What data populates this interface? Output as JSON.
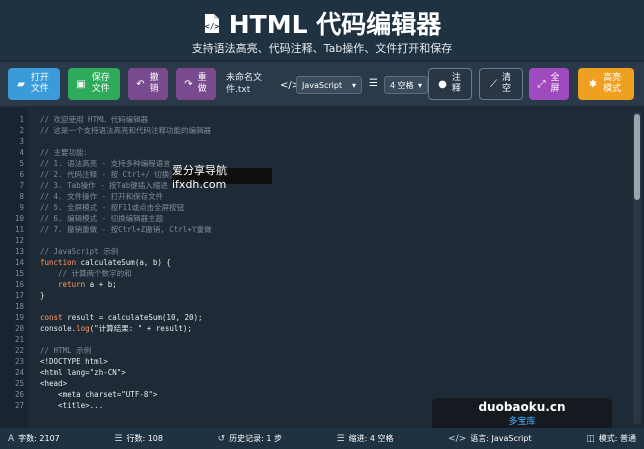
{
  "header": {
    "title": "HTML 代码编辑器",
    "subtitle": "支持语法高亮、代码注释、Tab操作、文件打开和保存"
  },
  "toolbar": {
    "open_label": "打开文件",
    "save_label": "保存文件",
    "undo_label": "撤销",
    "redo_label": "重做",
    "file_name": "未命名文件.txt",
    "language": "JavaScript",
    "indent": "4 空格",
    "comment_label": "注释",
    "clear_label": "清空",
    "fullscreen_label": "全屏",
    "highlight_label": "高亮模式"
  },
  "editor": {
    "lines": [
      {
        "n": "1",
        "t": "// 欢迎使用 HTML 代码编辑器",
        "c": "com"
      },
      {
        "n": "2",
        "t": "// 这是一个支持语法高亮和代码注释功能的编辑器",
        "c": "com"
      },
      {
        "n": "3",
        "t": "",
        "c": ""
      },
      {
        "n": "4",
        "t": "// 主要功能：",
        "c": "com"
      },
      {
        "n": "5",
        "t": "// 1. 语法高亮 - 支持多种编程语言",
        "c": "com"
      },
      {
        "n": "6",
        "t": "// 2. 代码注释 - 按 Ctrl+/ 切换注释",
        "c": "com"
      },
      {
        "n": "7",
        "t": "// 3. Tab操作 - 按Tab键插入缩进",
        "c": "com"
      },
      {
        "n": "8",
        "t": "// 4. 文件操作 - 打开和保存文件",
        "c": "com"
      },
      {
        "n": "9",
        "t": "// 5. 全屏模式 - 按F11或点击全屏按钮",
        "c": "com"
      },
      {
        "n": "10",
        "t": "// 6. 编辑模式 - 切换编辑器主题",
        "c": "com"
      },
      {
        "n": "11",
        "t": "// 7. 撤销重做 - 按Ctrl+Z撤销, Ctrl+Y重做",
        "c": "com"
      },
      {
        "n": "12",
        "t": "",
        "c": ""
      },
      {
        "n": "13",
        "t": "// JavaScript 示例",
        "c": "com"
      },
      {
        "n": "14",
        "t": "function calculateSum(a, b) {",
        "c": "fn"
      },
      {
        "n": "15",
        "t": "    // 计算两个数字的和",
        "c": "com"
      },
      {
        "n": "16",
        "t": "    return a + b;",
        "c": "ret"
      },
      {
        "n": "17",
        "t": "}",
        "c": ""
      },
      {
        "n": "18",
        "t": "",
        "c": ""
      },
      {
        "n": "19",
        "t": "const result = calculateSum(10, 20);",
        "c": "const"
      },
      {
        "n": "20",
        "t": "console.log(\"计算结果: \" + result);",
        "c": "log"
      },
      {
        "n": "21",
        "t": "",
        "c": ""
      },
      {
        "n": "22",
        "t": "// HTML 示例",
        "c": "com"
      },
      {
        "n": "23",
        "t": "<!DOCTYPE html>",
        "c": ""
      },
      {
        "n": "24",
        "t": "<html lang=\"zh-CN\">",
        "c": ""
      },
      {
        "n": "25",
        "t": "<head>",
        "c": ""
      },
      {
        "n": "26",
        "t": "    <meta charset=\"UTF-8\">",
        "c": ""
      },
      {
        "n": "27",
        "t": "    <title>...",
        "c": ""
      }
    ]
  },
  "watermarks": {
    "site1": "爱分享导航 ifxdh.com",
    "site2_domain": "duobaoku.cn",
    "site2_name": "多宝库"
  },
  "status": {
    "chars": "字数: 2107",
    "lines": "行数: 108",
    "history": "历史记录: 1 步",
    "indent": "缩进: 4 空格",
    "language": "语言: JavaScript",
    "mode": "模式: 普通"
  },
  "colors": {
    "header_bg": "#1f3242",
    "toolbar_bg": "#2a3a4a",
    "editor_bg": "#1e2a36",
    "accent_open": "#3b9ad9",
    "accent_save": "#2eaa5c",
    "accent_fullscreen": "#a04ac0",
    "accent_highlight": "#f0a020",
    "keyword": "#ff9a60",
    "comment": "#7f8c98"
  },
  "icons": {
    "title": "file-code-icon",
    "open": "folder-open-icon",
    "save": "save-icon",
    "undo": "undo-icon",
    "redo": "redo-icon",
    "language": "code-icon",
    "indent": "indent-icon",
    "comment": "comment-icon",
    "clear": "broom-icon",
    "fullscreen": "expand-icon",
    "highlight": "palette-icon"
  }
}
